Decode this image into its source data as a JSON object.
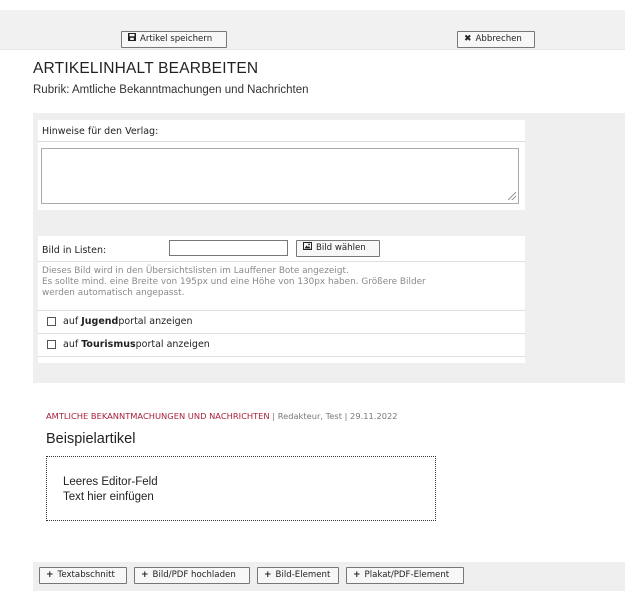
{
  "toolbar": {
    "save_label": "Artikel speichern",
    "cancel_label": "Abbrechen"
  },
  "page": {
    "title": "ARTIKELINHALT BEARBEITEN",
    "rubric": "Rubrik: Amtliche Bekanntmachungen und Nachrichten"
  },
  "hints": {
    "label": "Hinweise für den Verlag:",
    "value": ""
  },
  "list_image": {
    "label": "Bild in Listen:",
    "value": "",
    "button_label": "Bild wählen",
    "description_lines": [
      "Dieses Bild wird in den Übersichtslisten im Lauffener Bote angezeigt.",
      "Es sollte mind. eine Breite von 195px und eine Höhe von 130px haben. Größere Bilder",
      "werden automatisch angepasst."
    ]
  },
  "checkboxes": [
    {
      "prefix": "auf ",
      "bold": "Jugend",
      "suffix": "portal anzeigen",
      "checked": false
    },
    {
      "prefix": "auf ",
      "bold": "Tourismus",
      "suffix": "portal anzeigen",
      "checked": false
    }
  ],
  "article": {
    "category": "AMTLICHE BEKANNTMACHUNGEN UND NACHRICHTEN",
    "meta_rest": " | Redakteur, Test | 29.11.2022",
    "title": "Beispielartikel",
    "editor_line1": "Leeres Editor-Feld",
    "editor_line2": "Text hier einfügen"
  },
  "bottom_buttons": [
    "Textabschnitt",
    "Bild/PDF hochladen",
    "Bild-Element",
    "Plakat/PDF-Element"
  ],
  "colors": {
    "category_red": "#a8203a",
    "panel_gray": "#efefef"
  },
  "icons": {
    "save": "floppy-disk-icon",
    "cancel": "close-icon",
    "image": "image-icon",
    "add": "plus-icon"
  }
}
